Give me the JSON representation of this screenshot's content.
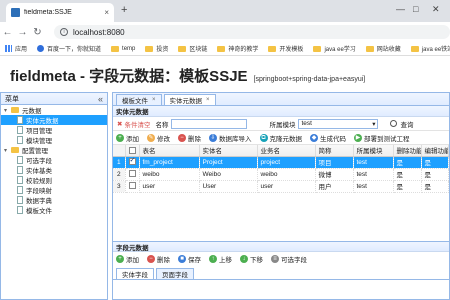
{
  "browser": {
    "tab_title": "fieldmeta:SSJE",
    "close_glyph": "×",
    "newtab_glyph": "+",
    "url": "localhost:8080",
    "window_controls": [
      "—",
      "□",
      "✕"
    ]
  },
  "bookmarks": [
    {
      "label": "应用",
      "icon": "apps-icon"
    },
    {
      "label": "百度一下，你就知道",
      "icon": "baidu-icon"
    },
    {
      "label": "temp",
      "icon": "folder-icon"
    },
    {
      "label": "投资",
      "icon": "folder-icon"
    },
    {
      "label": "区块链",
      "icon": "folder-icon"
    },
    {
      "label": "神奇的教学",
      "icon": "folder-icon"
    },
    {
      "label": "开发模板",
      "icon": "folder-icon"
    },
    {
      "label": "java ee学习",
      "icon": "folder-icon"
    },
    {
      "label": "网站收藏",
      "icon": "folder-icon"
    },
    {
      "label": "java ee铁站",
      "icon": "folder-icon"
    }
  ],
  "header": {
    "title": "fieldmeta - 字段元数据：模板SSJE",
    "subtitle": "[springboot+spring-data-jpa+easyui]"
  },
  "sidebar": {
    "title": "菜单",
    "collapse_glyph": "«",
    "nodes": [
      {
        "label": "元数据",
        "level": 0,
        "type": "folder",
        "expanded": true
      },
      {
        "label": "实体元数据",
        "level": 1,
        "type": "file",
        "selected": true
      },
      {
        "label": "项目管理",
        "level": 1,
        "type": "file"
      },
      {
        "label": "模块管理",
        "level": 1,
        "type": "file"
      },
      {
        "label": "配置管理",
        "level": 0,
        "type": "folder",
        "expanded": true
      },
      {
        "label": "可选字段",
        "level": 1,
        "type": "file"
      },
      {
        "label": "实体基类",
        "level": 1,
        "type": "file"
      },
      {
        "label": "校验规则",
        "level": 1,
        "type": "file"
      },
      {
        "label": "字段映射",
        "level": 1,
        "type": "file"
      },
      {
        "label": "数据字典",
        "level": 1,
        "type": "file"
      },
      {
        "label": "模板文件",
        "level": 1,
        "type": "file"
      }
    ]
  },
  "main": {
    "tabs": [
      {
        "label": "模板文件",
        "active": false
      },
      {
        "label": "实体元数据",
        "active": true
      }
    ],
    "tab_close_glyph": "×",
    "panel_title": "实体元数据",
    "search": {
      "cond_label": "条件清空",
      "name_label": "名称",
      "name_value": "",
      "module_label": "所属模块",
      "module_value": "test",
      "search_label": "查询"
    },
    "toolbar": [
      {
        "label": "添加",
        "icon": "add-icon",
        "cls": "g",
        "glyph": "+"
      },
      {
        "label": "修改",
        "icon": "edit-icon",
        "cls": "o",
        "glyph": "✎"
      },
      {
        "label": "删除",
        "icon": "delete-icon",
        "cls": "r",
        "glyph": "−"
      },
      {
        "label": "数据库导入",
        "icon": "db-import-icon",
        "cls": "b",
        "glyph": "⇩"
      },
      {
        "label": "克隆元数据",
        "icon": "clone-icon",
        "cls": "t",
        "glyph": "⧉"
      },
      {
        "label": "生成代码",
        "icon": "codegen-icon",
        "cls": "b",
        "glyph": "◆"
      },
      {
        "label": "部署到测试工程",
        "icon": "deploy-icon",
        "cls": "g",
        "glyph": "▶"
      }
    ],
    "grid": {
      "columns": [
        "表名",
        "实体名",
        "业务名",
        "简称",
        "所属模块",
        "删除功能",
        "编辑功能"
      ],
      "rows": [
        {
          "num": "1",
          "checked": true,
          "cells": [
            "fm_project",
            "Project",
            "project",
            "项目",
            "test",
            "是",
            "是"
          ]
        },
        {
          "num": "2",
          "checked": false,
          "cells": [
            "weibo",
            "Weibo",
            "weibo",
            "微博",
            "test",
            "是",
            "是"
          ]
        },
        {
          "num": "3",
          "checked": false,
          "cells": [
            "user",
            "User",
            "user",
            "用户",
            "test",
            "是",
            "是"
          ]
        }
      ]
    }
  },
  "lower": {
    "title": "字段元数据",
    "toolbar": [
      {
        "label": "添加",
        "icon": "add-icon",
        "cls": "g",
        "glyph": "+"
      },
      {
        "label": "删除",
        "icon": "delete-icon",
        "cls": "r",
        "glyph": "−"
      },
      {
        "label": "保存",
        "icon": "save-icon",
        "cls": "b",
        "glyph": "■"
      },
      {
        "label": "上移",
        "icon": "move-up-icon",
        "cls": "g",
        "glyph": "↑"
      },
      {
        "label": "下移",
        "icon": "move-down-icon",
        "cls": "g",
        "glyph": "↓"
      },
      {
        "label": "可选字段",
        "icon": "optional-fields-icon",
        "cls": "gy",
        "glyph": "≡"
      }
    ],
    "tabs": [
      {
        "label": "实体字段",
        "active": true
      },
      {
        "label": "页面字段",
        "active": false
      }
    ]
  }
}
